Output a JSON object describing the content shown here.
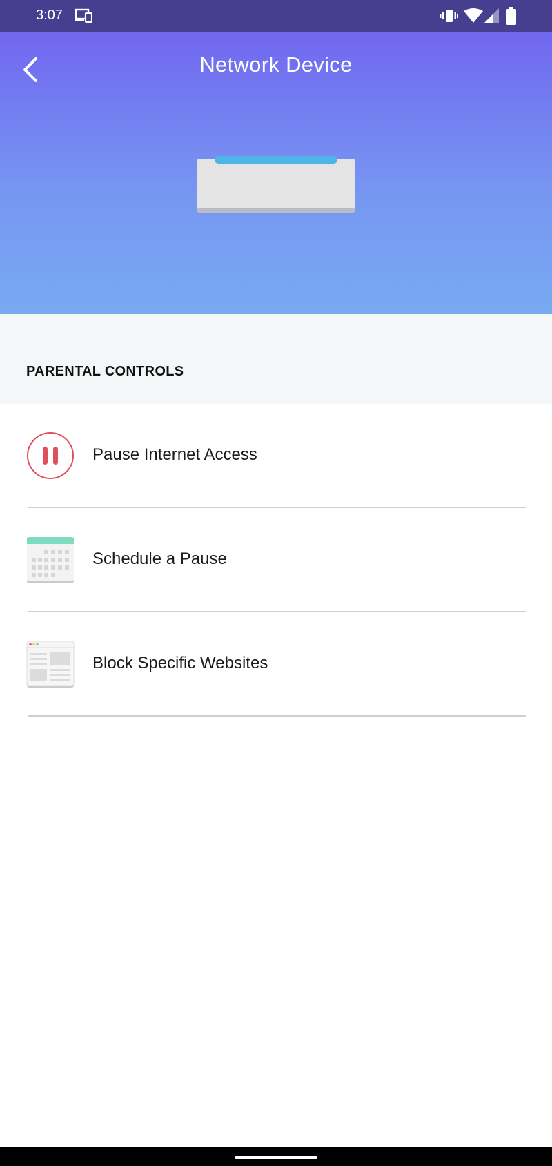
{
  "status_bar": {
    "time": "3:07",
    "icons": [
      "cast-icon",
      "vibrate-icon",
      "wifi-icon",
      "signal-icon",
      "battery-icon"
    ]
  },
  "header": {
    "title": "Network Device",
    "back_icon": "chevron-left-icon",
    "illustration": "network-device-illustration"
  },
  "section": {
    "title": "PARENTAL CONTROLS"
  },
  "items": [
    {
      "label": "Pause Internet Access",
      "icon": "pause-icon"
    },
    {
      "label": "Schedule a Pause",
      "icon": "calendar-icon"
    },
    {
      "label": "Block Specific Websites",
      "icon": "webpage-icon"
    }
  ],
  "colors": {
    "status_bar": "#463f8f",
    "gradient_top": "#7167f0",
    "gradient_bottom": "#78aaf2",
    "pause_red": "#e0505c",
    "calendar_teal": "#7ddcc0",
    "device_led": "#4fb4e8",
    "section_bg": "#f4f7f8"
  }
}
